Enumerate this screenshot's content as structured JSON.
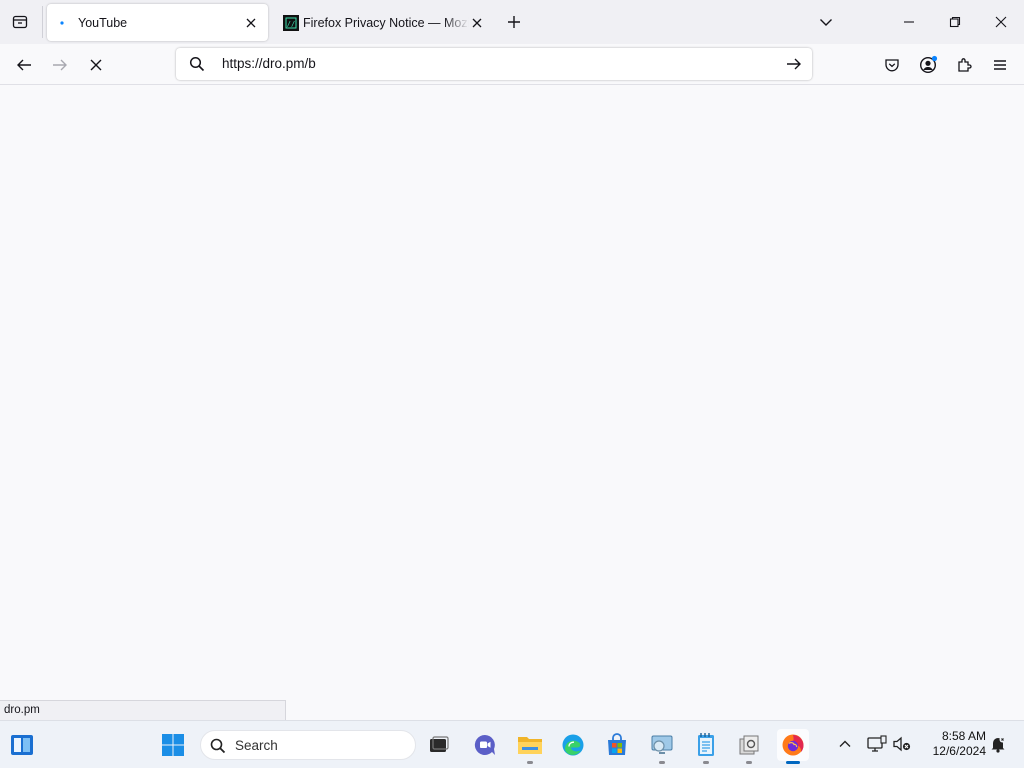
{
  "browser": {
    "tabs": [
      {
        "title": "YouTube",
        "active": true
      },
      {
        "title": "Firefox Privacy Notice — Mozilla",
        "active": false
      }
    ],
    "url": "https://dro.pm/b",
    "status_text": "dro.pm"
  },
  "icons": {
    "tab_list": "firefox-view-icon",
    "new_tab": "plus-icon",
    "list_all_tabs": "chevron-down-icon",
    "minimize": "minimize-icon",
    "restore": "restore-icon",
    "close": "close-icon",
    "back": "back-arrow-icon",
    "forward": "forward-arrow-icon",
    "stop": "stop-icon",
    "pocket": "pocket-icon",
    "account": "account-icon",
    "extensions": "extensions-icon",
    "menu": "hamburger-menu-icon"
  },
  "taskbar": {
    "search_label": "Search",
    "time": "8:58 AM",
    "date": "12/6/2024",
    "apps": [
      "widgets",
      "start",
      "task-view",
      "teams",
      "file-explorer",
      "edge",
      "store",
      "control-panel",
      "notepad",
      "settings-app",
      "firefox"
    ]
  },
  "colors": {
    "accent": "#0067c0",
    "tab_strip": "#f0f0f4",
    "page_bg": "#f9f9fb",
    "taskbar_bg": "#eef2f8"
  }
}
